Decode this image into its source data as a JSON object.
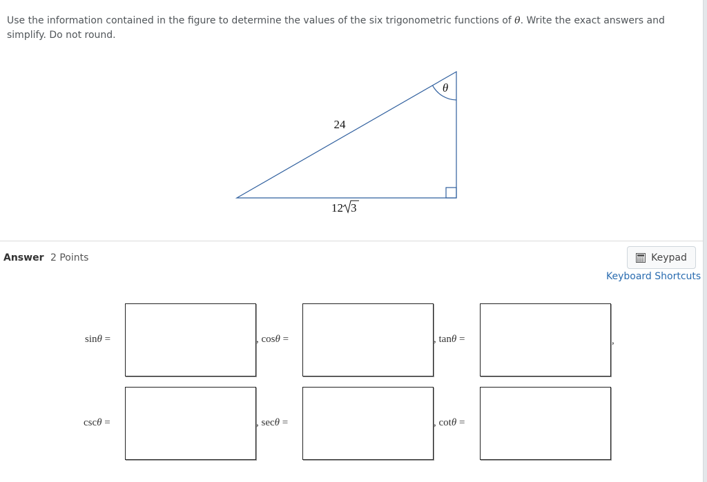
{
  "question": {
    "text_before": "Use the information contained in the figure to determine the values of the six trigonometric functions of ",
    "theta_symbol": "θ",
    "text_after": ". Write the exact answers and simplify. Do not round."
  },
  "figure": {
    "hypotenuse_label": "24",
    "base_label_coef": "12",
    "base_label_radicand": "3",
    "angle_label": "θ",
    "line_color": "#2f5f9e"
  },
  "answer_header": {
    "answer_label": "Answer",
    "points_label": "2 Points"
  },
  "tools": {
    "keypad_label": "Keypad",
    "keypad_icon": "calculator-icon",
    "shortcuts_label": "Keyboard Shortcuts"
  },
  "fields": [
    {
      "fn": "sin",
      "theta": "θ",
      "eq": " =",
      "value": "",
      "sep_before": ""
    },
    {
      "fn": "cos",
      "theta": "θ",
      "eq": " =",
      "value": "",
      "sep_before": ", "
    },
    {
      "fn": "tan",
      "theta": "θ",
      "eq": " =",
      "value": "",
      "sep_before": ", "
    },
    {
      "fn": "csc",
      "theta": "θ",
      "eq": " =",
      "value": "",
      "sep_before": ""
    },
    {
      "fn": "sec",
      "theta": "θ",
      "eq": " =",
      "value": "",
      "sep_before": ", "
    },
    {
      "fn": "cot",
      "theta": "θ",
      "eq": " =",
      "value": "",
      "sep_before": ", "
    }
  ],
  "trailing_comma": ","
}
